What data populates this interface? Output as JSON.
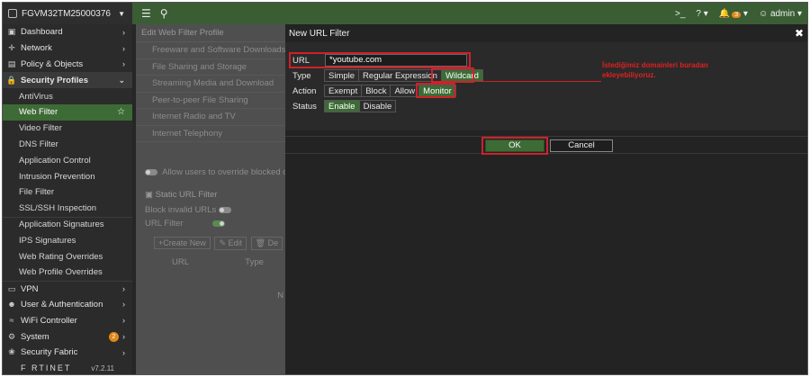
{
  "topbar": {
    "device_name": "FGVM32TM25000376",
    "right": {
      "cli": ">_",
      "help": "?",
      "alerts_count": "3",
      "user": "admin"
    }
  },
  "sidebar": {
    "items": [
      {
        "label": "Dashboard",
        "icon": "dashboard-icon",
        "section": false
      },
      {
        "label": "Network",
        "icon": "network-icon",
        "section": false
      },
      {
        "label": "Policy & Objects",
        "icon": "policy-icon",
        "section": false
      },
      {
        "label": "Security Profiles",
        "icon": "lock-icon",
        "section": true
      }
    ],
    "sub_items": [
      "AntiVirus",
      "Web Filter",
      "Video Filter",
      "DNS Filter",
      "Application Control",
      "Intrusion Prevention",
      "File Filter",
      "SSL/SSH Inspection",
      "Application Signatures",
      "IPS Signatures",
      "Web Rating Overrides",
      "Web Profile Overrides"
    ],
    "bottom_items": [
      {
        "label": "VPN",
        "icon": "vpn-icon"
      },
      {
        "label": "User & Authentication",
        "icon": "user-icon"
      },
      {
        "label": "WiFi Controller",
        "icon": "wifi-icon"
      },
      {
        "label": "System",
        "icon": "gear-icon",
        "badge": "2"
      },
      {
        "label": "Security Fabric",
        "icon": "fabric-icon"
      }
    ],
    "brand": "F  RTINET",
    "version": "v7.2.11"
  },
  "background_page": {
    "breadcrumb": "Edit Web Filter Profile",
    "categories": [
      "Freeware and Software Downloads",
      "File Sharing and Storage",
      "Streaming Media and Download",
      "Peer-to-peer File Sharing",
      "Internet Radio and TV",
      "Internet Telephony"
    ],
    "override_label": "Allow users to override blocked cat",
    "static_url_filter": "Static URL Filter",
    "block_invalid": "Block invalid URLs",
    "url_filter": "URL Filter",
    "create_new": "Create New",
    "edit": "Edit",
    "delete": "De",
    "col_url": "URL",
    "col_type": "Type",
    "no_results": "N"
  },
  "dialog": {
    "title": "New URL Filter",
    "url_label": "URL",
    "url_value": "*youtube.com",
    "type_label": "Type",
    "type_options": [
      "Simple",
      "Regular Expression",
      "Wildcard"
    ],
    "action_label": "Action",
    "action_options": [
      "Exempt",
      "Block",
      "Allow",
      "Monitor"
    ],
    "status_label": "Status",
    "status_options": [
      "Enable",
      "Disable"
    ],
    "ok": "OK",
    "cancel": "Cancel"
  },
  "annotation": {
    "line1": "İstediğimiz domainleri buradan",
    "line2": "ekleyebiliyoruz."
  },
  "colors": {
    "accent_green": "#3d6b35",
    "highlight_red": "#d0202a",
    "badge_orange": "#e0891a"
  }
}
